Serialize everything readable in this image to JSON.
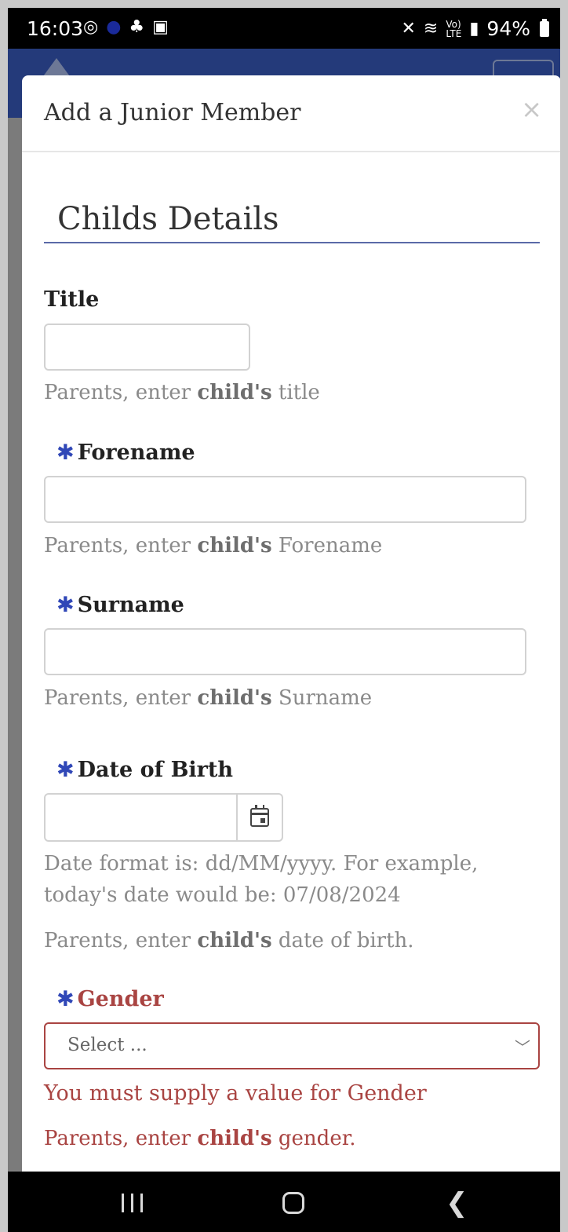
{
  "status_bar": {
    "time": "16:03",
    "left_icons": [
      "whatsapp-icon",
      "messenger-icon",
      "notification-icon",
      "gallery-icon"
    ],
    "right_icons": [
      "mute-icon",
      "wifi-icon",
      "volte-icon",
      "signal-icon"
    ],
    "battery": "94%"
  },
  "modal": {
    "title": "Add a Junior Member",
    "close_label": "×",
    "section_title": "Childs Details"
  },
  "fields": {
    "title": {
      "label": "Title",
      "value": "",
      "help_prefix": "Parents, enter ",
      "help_bold": "child's",
      "help_suffix": " title"
    },
    "forename": {
      "label": "Forename",
      "value": "",
      "help_prefix": "Parents, enter ",
      "help_bold": "child's",
      "help_suffix": " Forename"
    },
    "surname": {
      "label": "Surname",
      "value": "",
      "help_prefix": "Parents, enter ",
      "help_bold": "child's",
      "help_suffix": " Surname"
    },
    "dob": {
      "label": "Date of Birth",
      "value": "",
      "format_line1": "Date format is: dd/MM/yyyy. For example,",
      "format_line2": "today's date would be: 07/08/2024",
      "help_prefix": "Parents, enter ",
      "help_bold": "child's",
      "help_suffix": " date of birth."
    },
    "gender": {
      "label": "Gender",
      "selected": "Select ...",
      "error": "You must supply a value for Gender",
      "help_prefix": "Parents, enter ",
      "help_bold": "child's",
      "help_suffix": " gender."
    }
  },
  "required_marker": "✱",
  "colors": {
    "required": "#3047b7",
    "error": "#a94442",
    "header": "#243a7a"
  }
}
